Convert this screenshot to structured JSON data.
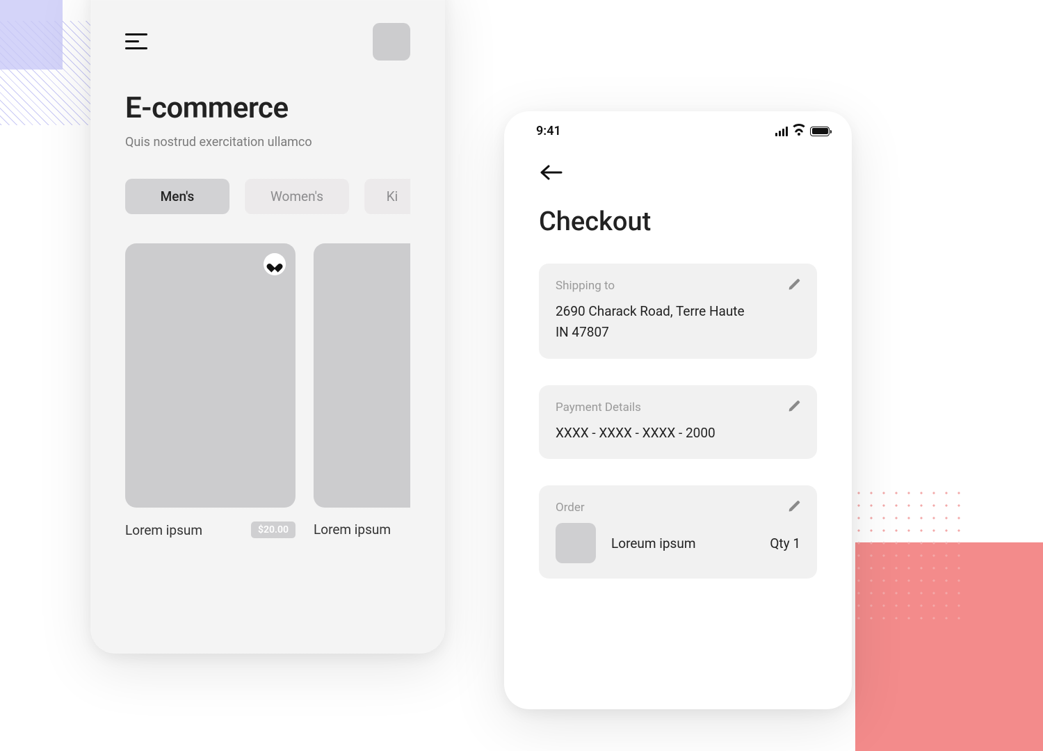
{
  "status": {
    "time": "9:41"
  },
  "screen1": {
    "title": "E-commerce",
    "subtitle": "Quis nostrud exercitation ullamco",
    "tabs": [
      "Men's",
      "Women's",
      "Kid's"
    ],
    "tab_partial": "Ki",
    "products": [
      {
        "name": "Lorem ipsum",
        "price": "$20.00",
        "favorited": true
      },
      {
        "name": "Lorem ipsum"
      }
    ]
  },
  "screen2": {
    "title": "Checkout",
    "shipping": {
      "label": "Shipping to",
      "line1": "2690  Charack Road, Terre Haute",
      "line2": "IN 47807"
    },
    "payment": {
      "label": "Payment Details",
      "value": "XXXX - XXXX - XXXX - 2000"
    },
    "order": {
      "label": "Order",
      "items": [
        {
          "name": "Loreum ipsum",
          "qty": "Qty 1"
        }
      ]
    }
  }
}
